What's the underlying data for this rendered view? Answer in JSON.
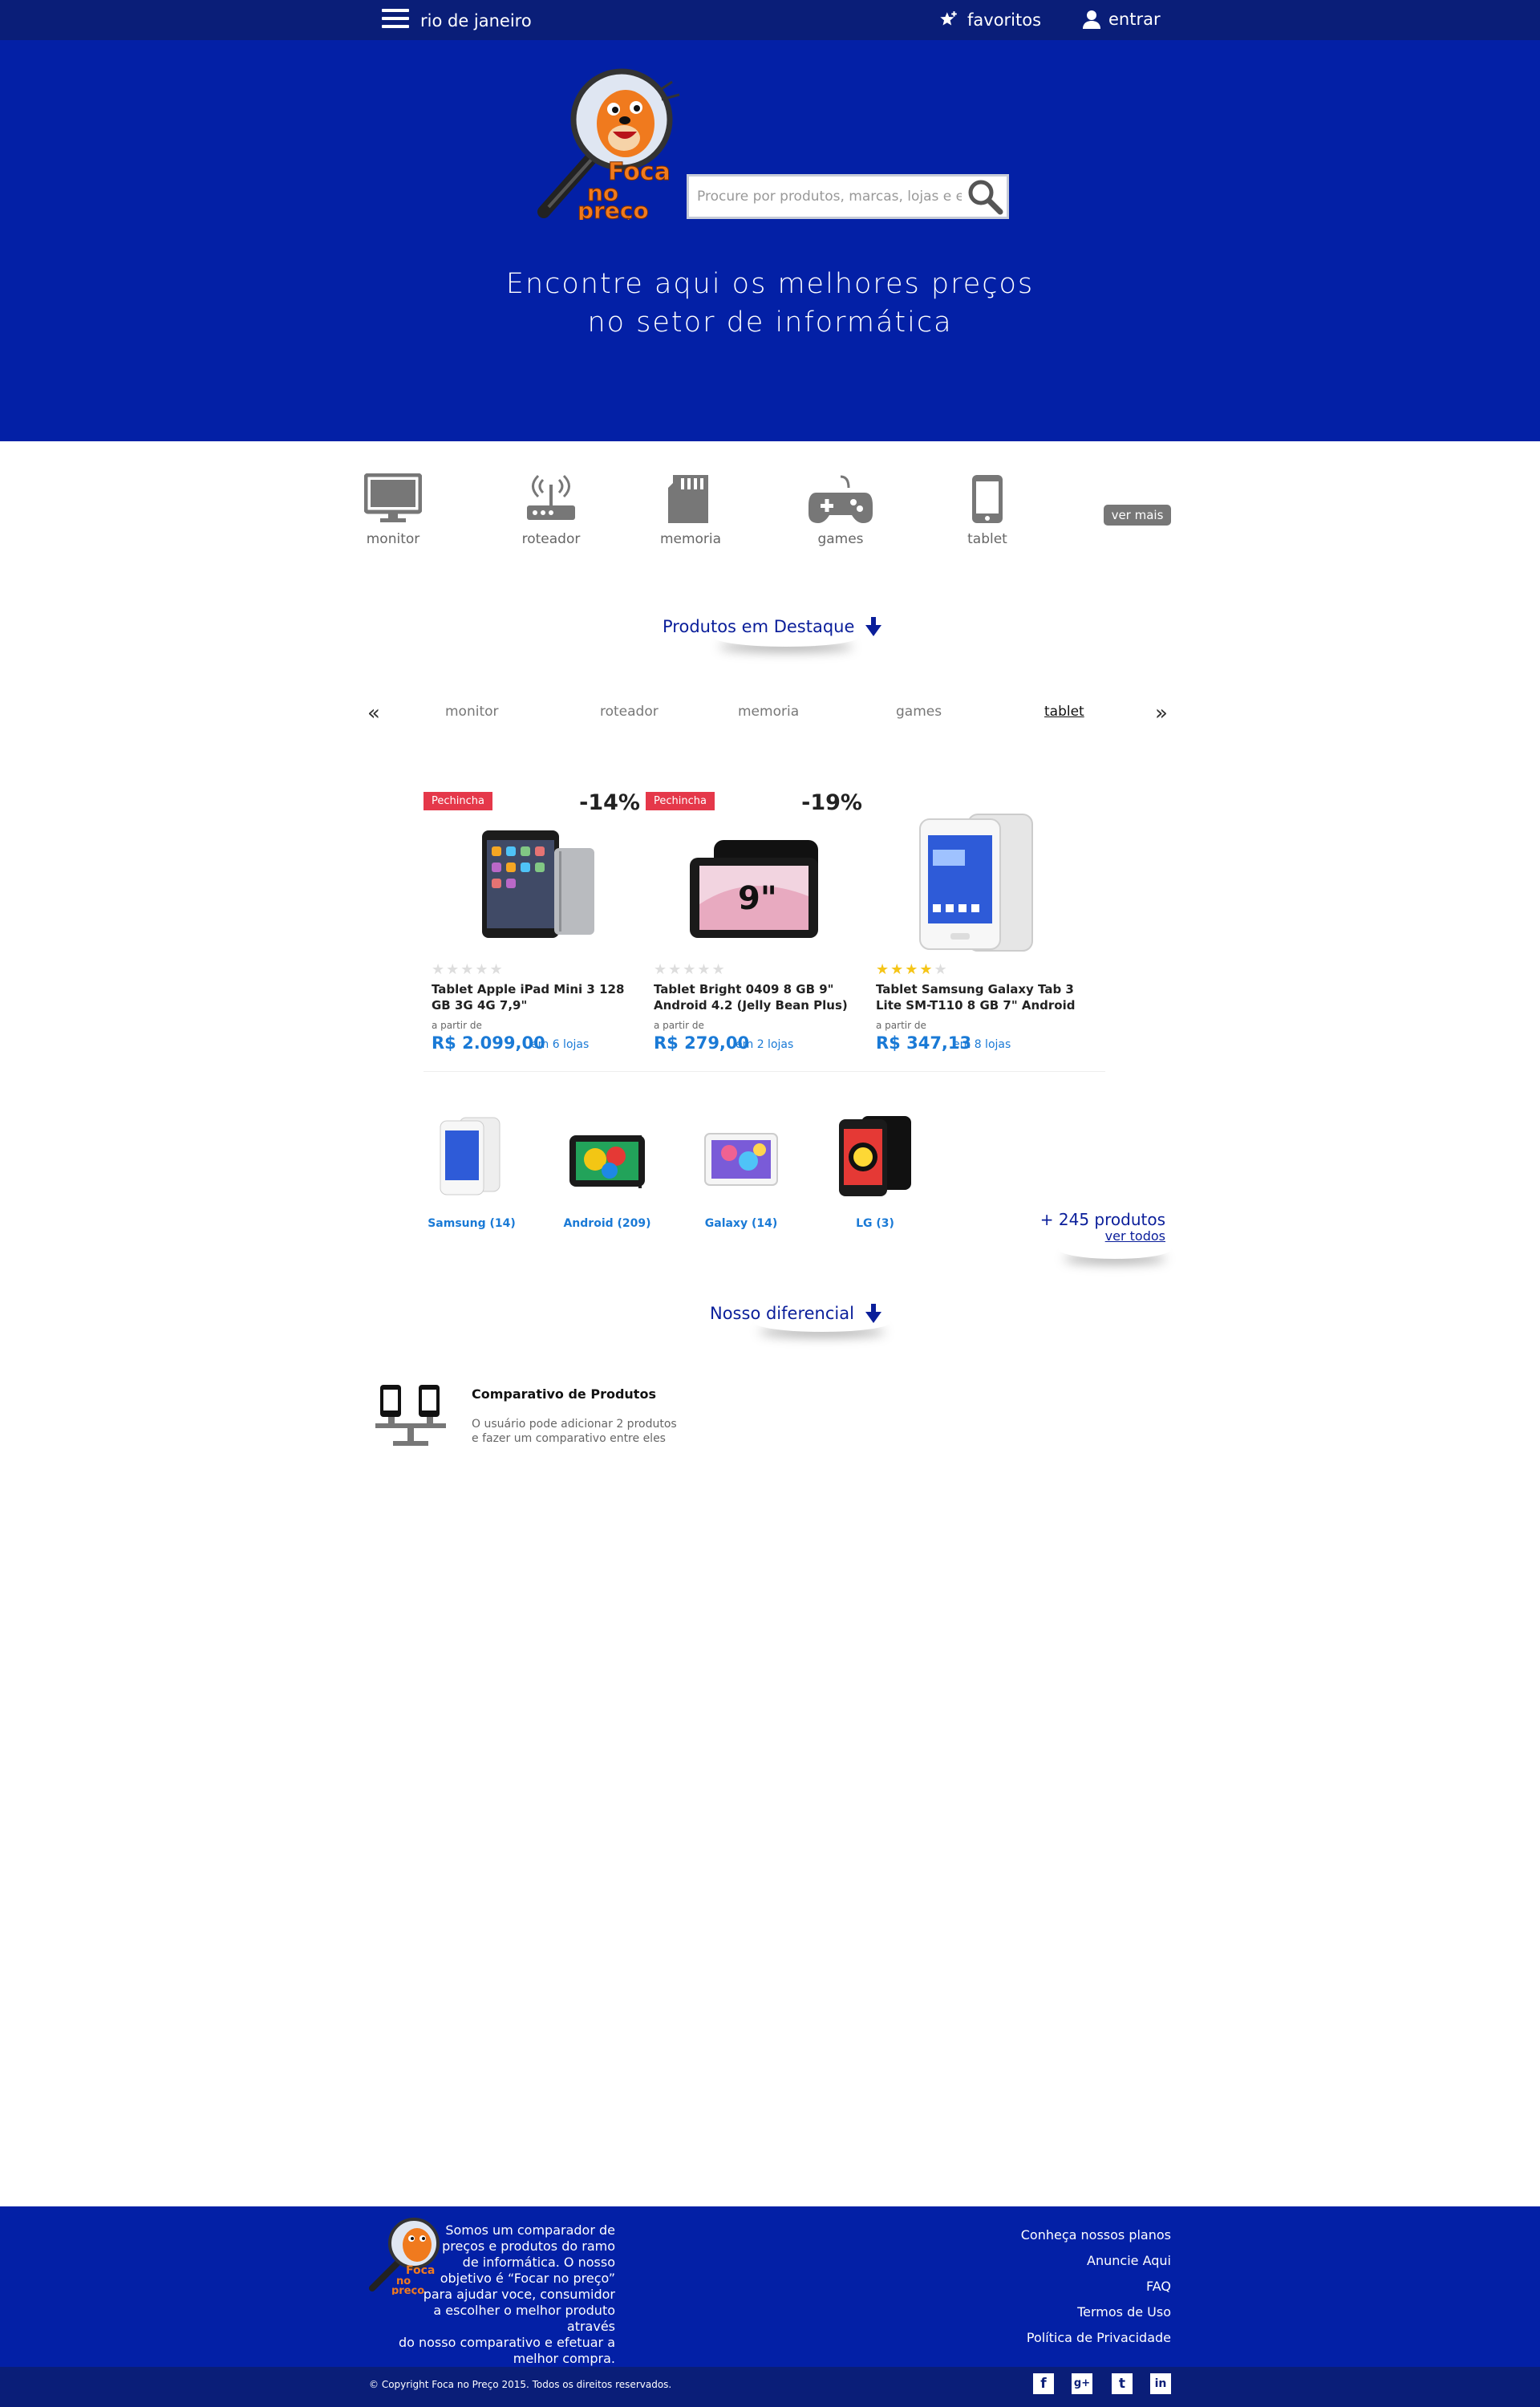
{
  "topbar": {
    "city": "rio de janeiro",
    "favorites_label": "favoritos",
    "login_label": "entrar"
  },
  "hero": {
    "logo_text": [
      "Foca",
      "no",
      "preço"
    ],
    "search_placeholder": "Procure por produtos, marcas, lojas e etc...",
    "tagline_line1": "Encontre aqui os melhores preços",
    "tagline_line2": "no setor de informática"
  },
  "categories": {
    "items": [
      {
        "label": "monitor",
        "icon": "monitor-icon"
      },
      {
        "label": "roteador",
        "icon": "router-icon"
      },
      {
        "label": "memoria",
        "icon": "memory-card-icon"
      },
      {
        "label": "games",
        "icon": "gamepad-icon"
      },
      {
        "label": "tablet",
        "icon": "tablet-icon"
      }
    ],
    "see_more": "ver mais"
  },
  "featured": {
    "title": "Produtos em Destaque",
    "tabs": [
      "monitor",
      "roteador",
      "memoria",
      "games",
      "tablet"
    ],
    "active_tab": "tablet",
    "products": [
      {
        "badge": "Pechincha",
        "discount": "-14%",
        "name": "Tablet Apple iPad Mini 3 128 GB 3G 4G 7,9\"",
        "rating": 0,
        "from_label": "a partir de",
        "price": "R$ 2.099,00",
        "stores": "em 6 lojas"
      },
      {
        "badge": "Pechincha",
        "discount": "-19%",
        "name": "Tablet Bright 0409 8 GB 9\" Android 4.2 (Jelly Bean Plus)",
        "rating": 0,
        "from_label": "a partir de",
        "price": "R$ 279,00",
        "stores": "em 2 lojas"
      },
      {
        "badge": "",
        "discount": "",
        "name": "Tablet Samsung Galaxy Tab 3 Lite SM-T110 8 GB 7\" Android",
        "rating": 4.5,
        "from_label": "a partir de",
        "price": "R$ 347,13",
        "stores": "em 8 lojas"
      }
    ],
    "brands": [
      {
        "label": "Samsung (14)"
      },
      {
        "label": "Android (209)"
      },
      {
        "label": "Galaxy (14)"
      },
      {
        "label": "LG (3)"
      }
    ],
    "more_products": "+ 245 produtos",
    "see_all": "ver todos"
  },
  "differential": {
    "title": "Nosso diferencial",
    "items": [
      {
        "title": "Comparativo de Produtos",
        "text_line1": "O usuário pode adicionar 2 produtos",
        "text_line2": "e fazer um comparativo entre eles"
      }
    ]
  },
  "footer": {
    "about": [
      "Somos um comparador de",
      "preços e produtos do ramo",
      "de informática. O nosso",
      "objetivo é “Focar no preço”",
      "para ajudar voce, consumidor",
      "a escolher o melhor produto através",
      "do nosso comparativo e efetuar a",
      "melhor compra."
    ],
    "links": [
      "Conheça nossos planos",
      "Anuncie Aqui",
      "FAQ",
      "Termos de Uso",
      "Política de Privacidade"
    ],
    "copyright": "© Copyright Foca no Preço 2015. Todos os direitos reservados.",
    "social": [
      {
        "icon": "facebook-icon",
        "glyph": "f"
      },
      {
        "icon": "google-plus-icon",
        "glyph": "g+"
      },
      {
        "icon": "twitter-icon",
        "glyph": "t"
      },
      {
        "icon": "linkedin-icon",
        "glyph": "in"
      }
    ]
  },
  "colors": {
    "topbar": "#0a1e78",
    "hero": "#0320a6",
    "accent_price": "#1a7ad6",
    "badge": "#e5384a",
    "logo_orange": "#f07a1e"
  }
}
